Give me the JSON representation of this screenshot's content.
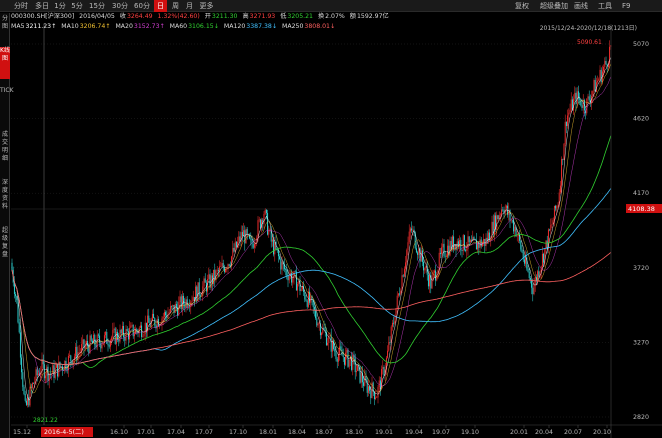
{
  "toolbar": {
    "period_tabs": [
      {
        "label": "分时",
        "active": false
      },
      {
        "label": "多日",
        "active": false
      },
      {
        "label": "1分",
        "active": false
      },
      {
        "label": "5分",
        "active": false
      },
      {
        "label": "15分",
        "active": false
      },
      {
        "label": "30分",
        "active": false
      },
      {
        "label": "60分",
        "active": false
      },
      {
        "label": "日",
        "active": true
      },
      {
        "label": "周",
        "active": false
      },
      {
        "label": "月",
        "active": false
      },
      {
        "label": "更多",
        "active": false
      }
    ],
    "right_tabs": [
      "复权",
      "超级叠加",
      "画线",
      "工具",
      "F9"
    ]
  },
  "quote": {
    "code": "000300.SH[沪深300]",
    "date": "2016/04/05",
    "close_label": "收",
    "close": "3264.49",
    "change": "1.32%(42.60)",
    "open_label": "开",
    "open": "3211.30",
    "high_label": "高",
    "high": "3271.93",
    "low_label": "低",
    "low": "3205.21",
    "turnover_label": "换",
    "turnover": "2.07%",
    "amount_label": "额",
    "amount": "1592.97亿"
  },
  "ma": [
    {
      "label": "MA5",
      "value": "3211.23↑",
      "color": "#ffffff"
    },
    {
      "label": "MA10",
      "value": "3206.74↑",
      "color": "#f0c030"
    },
    {
      "label": "MA20",
      "value": "3152.73↑",
      "color": "#d040d0"
    },
    {
      "label": "MA60",
      "value": "3106.15↓",
      "color": "#30d030"
    },
    {
      "label": "MA120",
      "value": "3387.38↓",
      "color": "#40c0ff"
    },
    {
      "label": "MA250",
      "value": "3808.01↓",
      "color": "#ff6060"
    }
  ],
  "sidebar": [
    "分图",
    "K线图",
    "TICK",
    "成交明细",
    "深度资料",
    "超级复盘"
  ],
  "chart": {
    "range_text": "2015/12/24-2020/12/18(1213日)",
    "current_price": "4108.38",
    "max_label": "5090.61",
    "min_label": "2821.22",
    "date_tag": "2016-4-5(二)",
    "y_ticks": [
      "5070",
      "4620",
      "4170",
      "3720",
      "3270",
      "2820"
    ],
    "x_ticks": [
      "15.12",
      "16.10",
      "17.01",
      "17.04",
      "17.07",
      "17.10",
      "18.01",
      "18.04",
      "18.07",
      "18.10",
      "19.01",
      "19.04",
      "19.07",
      "19.10",
      "20.01",
      "20.04",
      "20.07",
      "20.10"
    ],
    "colors": {
      "up": "#ff3030",
      "down": "#30e0e0",
      "ma5": "#ffffff",
      "ma10": "#f0c030",
      "ma20": "#d040d0",
      "ma60": "#30d030",
      "ma120": "#40c0ff",
      "ma250": "#ff6060"
    }
  },
  "chart_data": {
    "type": "line",
    "title": "000300.SH[沪深300]",
    "ylim": [
      2820,
      5070
    ],
    "x": [
      "15.12",
      "16.10",
      "17.01",
      "17.04",
      "17.07",
      "17.10",
      "18.01",
      "18.04",
      "18.07",
      "18.10",
      "19.01",
      "19.04",
      "19.07",
      "19.10",
      "20.01",
      "20.04",
      "20.07",
      "20.10"
    ],
    "series": [
      {
        "name": "MA5",
        "values": [
          3300,
          3320,
          3350,
          3450,
          3640,
          3820,
          4100,
          3800,
          3500,
          3230,
          3070,
          3930,
          3850,
          3950,
          4100,
          3690,
          4750,
          4750
        ]
      },
      {
        "name": "MA250",
        "values": [
          3880,
          3230,
          3300,
          3330,
          3400,
          3560,
          3650,
          3750,
          3760,
          3680,
          3420,
          3420,
          3500,
          3650,
          3800,
          3950,
          4050,
          4300
        ]
      }
    ]
  }
}
